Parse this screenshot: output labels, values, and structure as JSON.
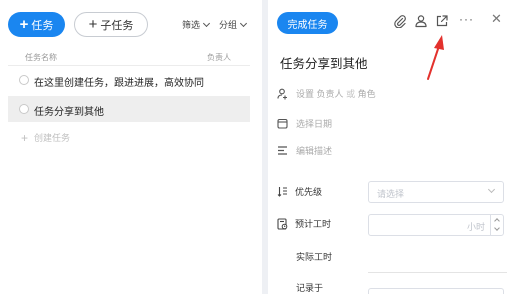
{
  "toolbar": {
    "add_task_label": "任务",
    "add_subtask_label": "子任务",
    "filter_label": "筛选",
    "group_label": "分组"
  },
  "list": {
    "col_name": "任务名称",
    "col_assignee": "负责人",
    "rows": [
      {
        "title": "在这里创建任务，跟进进展，高效协同",
        "selected": false
      },
      {
        "title": "任务分享到其他",
        "selected": true
      }
    ],
    "add_placeholder": "创建任务"
  },
  "detail": {
    "complete_button": "完成任务",
    "title": "任务分享到其他",
    "assignee_set": "设置",
    "assignee_who": "负责人",
    "assignee_or": "或",
    "assignee_role": "角色",
    "date_placeholder": "选择日期",
    "desc_placeholder": "编辑描述",
    "priority_label": "优先级",
    "priority_placeholder": "请选择",
    "estimate_label": "预计工时",
    "estimate_unit": "小时",
    "actual_label": "实际工时",
    "log_label": "记录于"
  },
  "colors": {
    "accent": "#1a86f0",
    "annotation": "#e3312d"
  }
}
